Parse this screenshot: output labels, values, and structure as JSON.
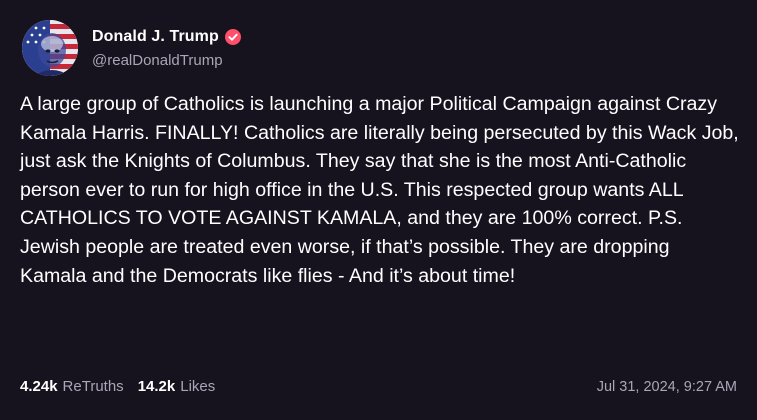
{
  "author": {
    "display_name": "Donald J. Trump",
    "handle": "@realDonaldTrump",
    "verified_icon": "verified-badge-icon",
    "verified_color": "#ff4f6a"
  },
  "post": {
    "text": "A large group of Catholics is launching a major Political Campaign against Crazy Kamala Harris. FINALLY! Catholics are literally being persecuted by this Wack Job, just ask the Knights of Columbus. They say that she is the most Anti-Catholic person ever to run for high office in the U.S. This respected group wants ALL CATHOLICS TO VOTE AGAINST KAMALA, and they are 100% correct. P.S. Jewish people are treated even worse, if that’s possible. They are dropping Kamala and the Democrats like flies - And it’s about time!"
  },
  "stats": {
    "retruths_count": "4.24k",
    "retruths_label": "ReTruths",
    "likes_count": "14.2k",
    "likes_label": "Likes"
  },
  "timestamp": "Jul 31, 2024, 9:27 AM",
  "colors": {
    "background": "#16131f",
    "text": "#ffffff",
    "muted": "#a9a6b5"
  }
}
